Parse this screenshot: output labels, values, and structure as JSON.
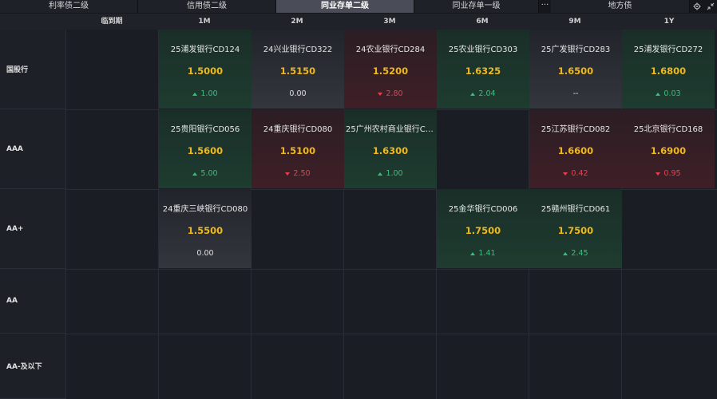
{
  "tabs": [
    {
      "label": "利率债二级",
      "active": false
    },
    {
      "label": "信用债二级",
      "active": false
    },
    {
      "label": "同业存单二级",
      "active": true
    },
    {
      "label": "同业存单一级",
      "active": false
    },
    {
      "label": "地方债",
      "active": false
    }
  ],
  "more_label": "···",
  "icons": {
    "settings": "gear-icon",
    "collapse": "collapse-arrows-icon"
  },
  "columns": [
    "临到期",
    "1M",
    "2M",
    "3M",
    "6M",
    "9M",
    "1Y"
  ],
  "rows": [
    "国股行",
    "AAA",
    "AA+",
    "AA",
    "AA-及以下"
  ],
  "colors": {
    "price": "#f0b81c",
    "up": "#31c47a",
    "down": "#e8404f",
    "background": "#1b1d24"
  },
  "cells": [
    {
      "row": 0,
      "col": 1,
      "name": "25浦发银行CD124",
      "price": "1.5000",
      "change": "1.00",
      "dir": "up"
    },
    {
      "row": 0,
      "col": 2,
      "name": "24兴业银行CD322",
      "price": "1.5150",
      "change": "0.00",
      "dir": "flat"
    },
    {
      "row": 0,
      "col": 3,
      "name": "24农业银行CD284",
      "price": "1.5200",
      "change": "2.80",
      "dir": "down"
    },
    {
      "row": 0,
      "col": 4,
      "name": "25农业银行CD303",
      "price": "1.6325",
      "change": "2.04",
      "dir": "up"
    },
    {
      "row": 0,
      "col": 5,
      "name": "25广发银行CD283",
      "price": "1.6500",
      "change": "--",
      "dir": "flat"
    },
    {
      "row": 0,
      "col": 6,
      "name": "25浦发银行CD272",
      "price": "1.6800",
      "change": "0.03",
      "dir": "up"
    },
    {
      "row": 1,
      "col": 1,
      "name": "25贵阳银行CD056",
      "price": "1.5600",
      "change": "5.00",
      "dir": "up"
    },
    {
      "row": 1,
      "col": 2,
      "name": "24重庆银行CD080",
      "price": "1.5100",
      "change": "2.50",
      "dir": "down"
    },
    {
      "row": 1,
      "col": 3,
      "name": "25广州农村商业银行CD...",
      "price": "1.6300",
      "change": "1.00",
      "dir": "up"
    },
    {
      "row": 1,
      "col": 5,
      "name": "25江苏银行CD082",
      "price": "1.6600",
      "change": "0.42",
      "dir": "down"
    },
    {
      "row": 1,
      "col": 6,
      "name": "25北京银行CD168",
      "price": "1.6900",
      "change": "0.95",
      "dir": "down"
    },
    {
      "row": 2,
      "col": 1,
      "name": "24重庆三峡银行CD080",
      "price": "1.5500",
      "change": "0.00",
      "dir": "flat"
    },
    {
      "row": 2,
      "col": 4,
      "name": "25金华银行CD006",
      "price": "1.7500",
      "change": "1.41",
      "dir": "up"
    },
    {
      "row": 2,
      "col": 5,
      "name": "25赣州银行CD061",
      "price": "1.7500",
      "change": "2.45",
      "dir": "up"
    }
  ]
}
